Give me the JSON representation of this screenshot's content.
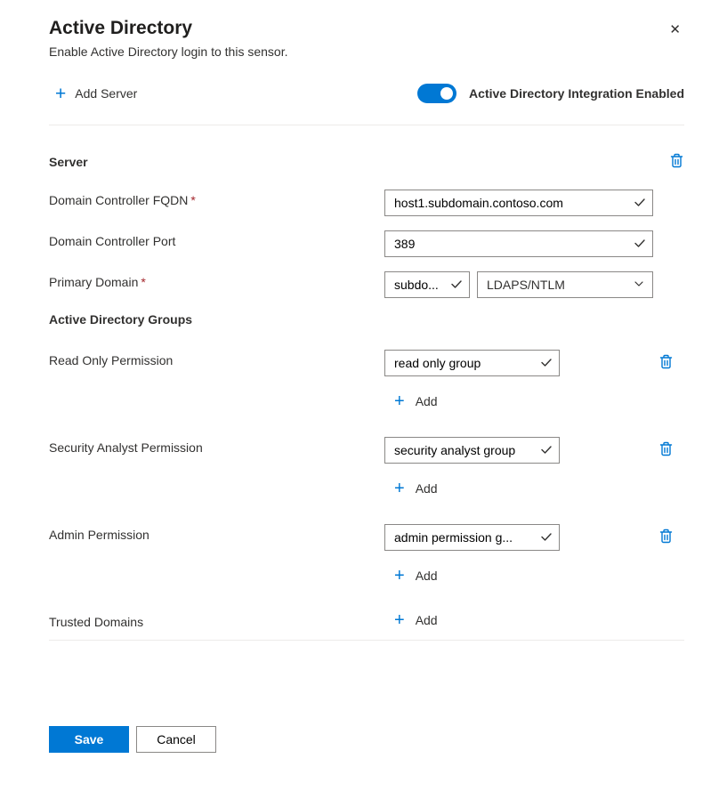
{
  "header": {
    "title": "Active Directory",
    "subtitle": "Enable Active Directory login to this sensor."
  },
  "top": {
    "add_server": "Add Server",
    "toggle_label": "Active Directory Integration Enabled",
    "toggle_on": true
  },
  "server": {
    "heading": "Server",
    "fields": {
      "fqdn_label": "Domain Controller FQDN",
      "fqdn_value": "host1.subdomain.contoso.com",
      "port_label": "Domain Controller Port",
      "port_value": "389",
      "primary_domain_label": "Primary Domain",
      "primary_domain_value": "subdo...",
      "protocol_value": "LDAPS/NTLM"
    }
  },
  "groups": {
    "heading": "Active Directory Groups",
    "read_only": {
      "label": "Read Only Permission",
      "value": "read only group",
      "add": "Add"
    },
    "security_analyst": {
      "label": "Security Analyst Permission",
      "value": "security analyst group",
      "add": "Add"
    },
    "admin": {
      "label": "Admin Permission",
      "value": "admin permission g...",
      "add": "Add"
    },
    "trusted": {
      "label": "Trusted Domains",
      "add": "Add"
    }
  },
  "footer": {
    "save": "Save",
    "cancel": "Cancel"
  },
  "icons": {
    "plus": "plus",
    "close": "close",
    "trash": "trash",
    "check": "check",
    "chevron": "chevron"
  },
  "colors": {
    "accent": "#0078d4",
    "required": "#a4262c"
  }
}
